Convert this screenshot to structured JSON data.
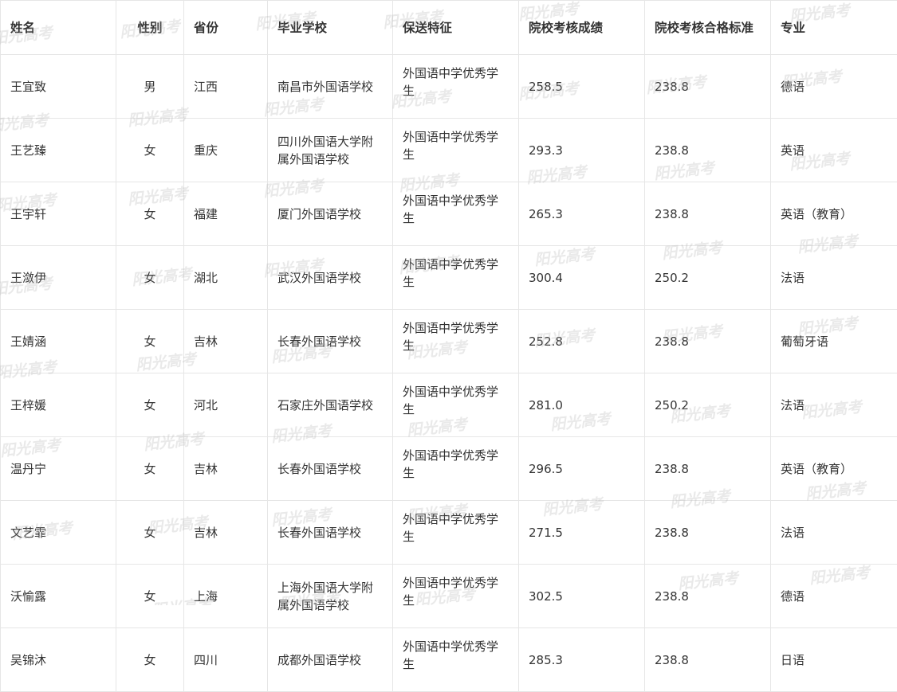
{
  "table": {
    "headers": [
      "姓名",
      "性别",
      "省份",
      "毕业学校",
      "保送特征",
      "院校考核成绩",
      "院校考核合格标准",
      "专业"
    ],
    "rows": [
      [
        "王宜致",
        "男",
        "江西",
        "南昌市外国语学校",
        "外国语中学优秀学生",
        "258.5",
        "238.8",
        "德语"
      ],
      [
        "王艺臻",
        "女",
        "重庆",
        "四川外国语大学附属外国语学校",
        "外国语中学优秀学生",
        "293.3",
        "238.8",
        "英语"
      ],
      [
        "王宇轩",
        "女",
        "福建",
        "厦门外国语学校",
        "外国语中学优秀学生",
        "265.3",
        "238.8",
        "英语（教育）"
      ],
      [
        "王潋伊",
        "女",
        "湖北",
        "武汉外国语学校",
        "外国语中学优秀学生",
        "300.4",
        "250.2",
        "法语"
      ],
      [
        "王婧涵",
        "女",
        "吉林",
        "长春外国语学校",
        "外国语中学优秀学生",
        "252.8",
        "238.8",
        "葡萄牙语"
      ],
      [
        "王梓媛",
        "女",
        "河北",
        "石家庄外国语学校",
        "外国语中学优秀学生",
        "281.0",
        "250.2",
        "法语"
      ],
      [
        "温丹宁",
        "女",
        "吉林",
        "长春外国语学校",
        "外国语中学优秀学生",
        "296.5",
        "238.8",
        "英语（教育）"
      ],
      [
        "文艺霏",
        "女",
        "吉林",
        "长春外国语学校",
        "外国语中学优秀学生",
        "271.5",
        "238.8",
        "法语"
      ],
      [
        "沃愉露",
        "女",
        "上海",
        "上海外国语大学附属外国语学校",
        "外国语中学优秀学生",
        "302.5",
        "238.8",
        "德语"
      ],
      [
        "吴锦沐",
        "女",
        "四川",
        "成都外国语学校",
        "外国语中学优秀学生",
        "285.3",
        "238.8",
        "日语"
      ]
    ]
  },
  "watermark": {
    "text": "阳光高考"
  }
}
